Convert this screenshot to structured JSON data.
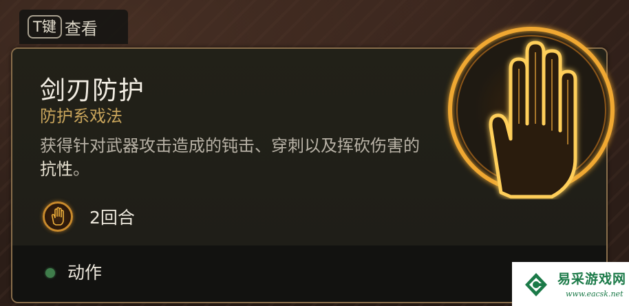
{
  "key_hint": {
    "key": "T键",
    "action": "查看"
  },
  "spell": {
    "name": "剑刃防护",
    "school": "防护系戏法",
    "description_pre": "获得针对武器攻击造成的钝击、穿刺以及挥砍伤害的",
    "description_highlight": "抗性",
    "description_post": "。",
    "duration": "2回合",
    "cost": "动作",
    "icon": "glowing-hand-icon"
  },
  "watermark": {
    "name": "易采游戏网",
    "url": "www.eacsk.net"
  },
  "colors": {
    "panel_border": "#8a6f4c",
    "school_text": "#c8a45b",
    "icon_glow": "#f0a830",
    "action_dot": "#3f7d4b",
    "watermark_green": "#1b7a48"
  }
}
